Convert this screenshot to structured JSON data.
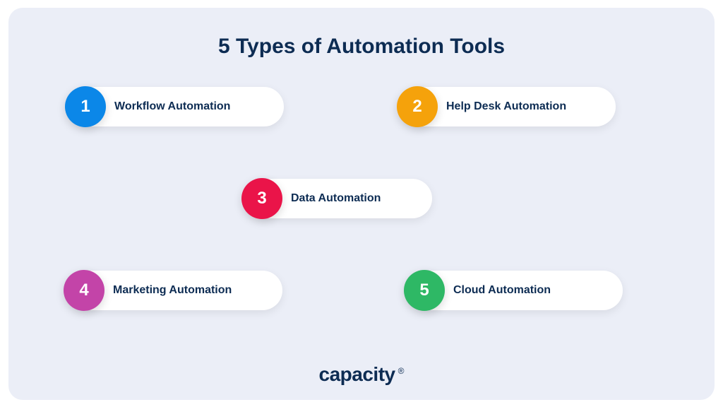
{
  "title": "5 Types of Automation Tools",
  "items": [
    {
      "num": "1",
      "label": "Workflow Automation",
      "color": "#0b87e8"
    },
    {
      "num": "2",
      "label": "Help Desk Automation",
      "color": "#f5a20b"
    },
    {
      "num": "3",
      "label": "Data Automation",
      "color": "#ea1449"
    },
    {
      "num": "4",
      "label": "Marketing Automation",
      "color": "#c344a8"
    },
    {
      "num": "5",
      "label": "Cloud Automation",
      "color": "#2eb865"
    }
  ],
  "brand": {
    "name": "capacity",
    "registered": "®"
  }
}
